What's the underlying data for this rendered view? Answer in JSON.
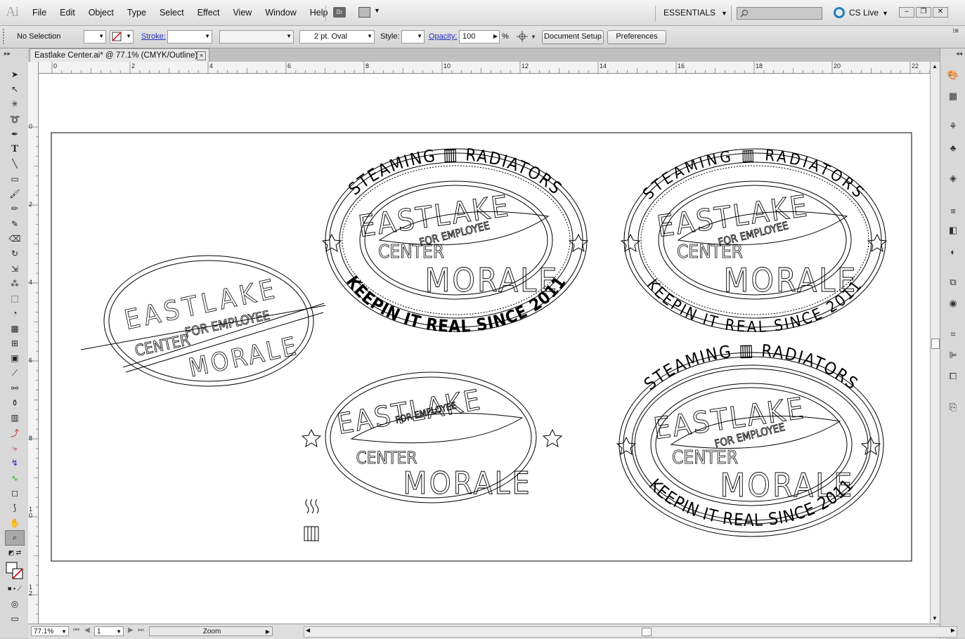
{
  "app": {
    "logo": "Ai"
  },
  "menu": [
    "File",
    "Edit",
    "Object",
    "Type",
    "Select",
    "Effect",
    "View",
    "Window",
    "Help"
  ],
  "bridge_label": "Br",
  "workspace": {
    "label": "ESSENTIALS"
  },
  "cs_live": "CS Live",
  "control": {
    "selection": "No Selection",
    "stroke_label": "Stroke:",
    "brush": "2 pt. Oval",
    "style_label": "Style:",
    "opacity_label": "Opacity:",
    "opacity_value": "100",
    "opacity_unit": "%",
    "document_setup": "Document Setup",
    "preferences": "Preferences"
  },
  "document_tab": {
    "title": "Eastlake Center.ai* @ 77.1% (CMYK/Outline)",
    "close": "×"
  },
  "ruler_h": [
    "0",
    "2",
    "4",
    "6",
    "8",
    "10",
    "12",
    "14",
    "16",
    "18",
    "20",
    "22"
  ],
  "ruler_v": [
    "0",
    "2",
    "4",
    "6",
    "8",
    "1\n0",
    "1\n2"
  ],
  "artwork": {
    "top_arc": "STEAMING ▥ RADIATORS",
    "bottom_arc": "KEEPIN IT REAL SINCE 2011",
    "line1": "EASTLAKE",
    "line2": "CENTER",
    "line2b": "FOR EMPLOYEE",
    "line3": "MORALE"
  },
  "status": {
    "zoom": "77.1%",
    "page": "1",
    "mode": "Zoom"
  }
}
